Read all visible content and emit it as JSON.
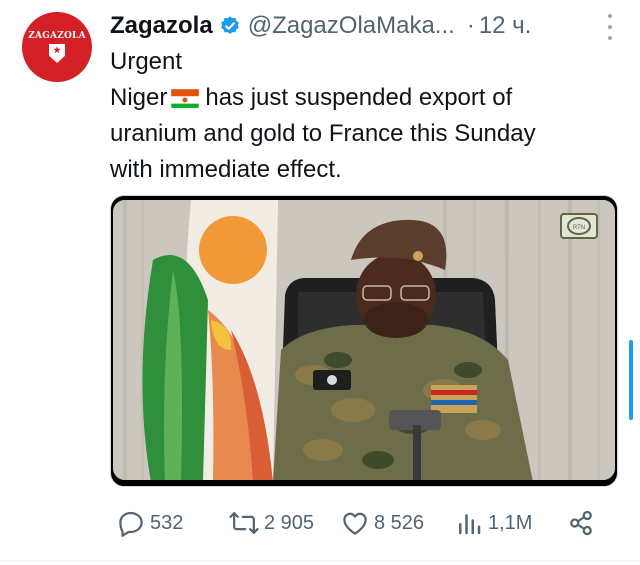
{
  "avatar": {
    "text": "ZAGAZOLA"
  },
  "tweet": {
    "name": "Zagazola",
    "handle": "@ZagazOlaMaka...",
    "separator": "·",
    "time": "12 ч.",
    "line1": "Urgent",
    "line2_before": "Niger",
    "line2_after": "has just suspended export of",
    "line3": "uranium and gold to France this Sunday",
    "line4": "with immediate effect."
  },
  "media": {
    "channel_logo": "RTN"
  },
  "actions": {
    "replies": "532",
    "reposts": "2 905",
    "likes": "8 526",
    "views": "1,1M"
  },
  "icons": [
    "verified-badge-icon",
    "more-options-icon",
    "niger-flag-icon",
    "reply-icon",
    "repost-icon",
    "like-icon",
    "views-icon",
    "share-icon"
  ],
  "colors": {
    "accent": "#1d9bf0",
    "text": "#0f1419",
    "muted": "#536471",
    "avatar": "#d32026"
  }
}
